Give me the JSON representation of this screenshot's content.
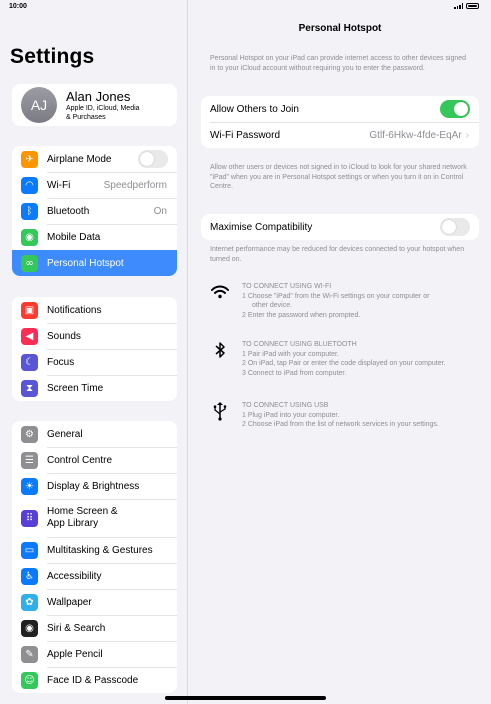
{
  "status": {
    "time": "10:00"
  },
  "sidebar": {
    "title": "Settings",
    "profile": {
      "initials": "AJ",
      "name": "Alan Jones",
      "sub1": "Apple ID, iCloud, Media",
      "sub2": "& Purchases"
    },
    "group1": [
      {
        "label": "Airplane Mode",
        "icon": "airplane-icon",
        "color": "#ff9500",
        "glyph": "✈",
        "control": "toggle",
        "on": false
      },
      {
        "label": "Wi-Fi",
        "icon": "wifi-icon",
        "color": "#0a7aff",
        "glyph": "◠",
        "value": "Speedperform"
      },
      {
        "label": "Bluetooth",
        "icon": "bluetooth-icon",
        "color": "#0a7aff",
        "glyph": "ᛒ",
        "value": "On"
      },
      {
        "label": "Mobile Data",
        "icon": "antenna-icon",
        "color": "#34c759",
        "glyph": "◉"
      },
      {
        "label": "Personal Hotspot",
        "icon": "hotspot-icon",
        "color": "#34c759",
        "glyph": "∞",
        "selected": true
      }
    ],
    "group2": [
      {
        "label": "Notifications",
        "icon": "bell-icon",
        "color": "#ff3b30",
        "glyph": "▣"
      },
      {
        "label": "Sounds",
        "icon": "speaker-icon",
        "color": "#ff2d55",
        "glyph": "◀"
      },
      {
        "label": "Focus",
        "icon": "moon-icon",
        "color": "#5856d6",
        "glyph": "☾"
      },
      {
        "label": "Screen Time",
        "icon": "hourglass-icon",
        "color": "#5856d6",
        "glyph": "⧗"
      }
    ],
    "group3": [
      {
        "label": "General",
        "icon": "gear-icon",
        "color": "#8e8e93",
        "glyph": "⚙"
      },
      {
        "label": "Control Centre",
        "icon": "switches-icon",
        "color": "#8e8e93",
        "glyph": "☰"
      },
      {
        "label": "Display & Brightness",
        "icon": "sun-icon",
        "color": "#0a7aff",
        "glyph": "☀"
      },
      {
        "label1": "Home Screen &",
        "label2": "App Library",
        "icon": "grid-icon",
        "color": "#5a3fd6",
        "glyph": "⠿",
        "tall": true
      },
      {
        "label": "Multitasking & Gestures",
        "icon": "multitask-icon",
        "color": "#0a7aff",
        "glyph": "▭"
      },
      {
        "label": "Accessibility",
        "icon": "accessibility-icon",
        "color": "#0a7aff",
        "glyph": "♿"
      },
      {
        "label": "Wallpaper",
        "icon": "flower-icon",
        "color": "#30b0e8",
        "glyph": "✿"
      },
      {
        "label": "Siri & Search",
        "icon": "siri-icon",
        "color": "#222",
        "glyph": "◉"
      },
      {
        "label": "Apple Pencil",
        "icon": "pencil-icon",
        "color": "#8e8e93",
        "glyph": "✎"
      },
      {
        "label": "Face ID & Passcode",
        "icon": "faceid-icon",
        "color": "#34c759",
        "glyph": "☺"
      }
    ]
  },
  "main": {
    "title": "Personal Hotspot",
    "intro": "Personal Hotspot on your iPad can provide internet access to other devices signed in to your iCloud account without requiring you to enter the password.",
    "allow_label": "Allow Others to Join",
    "allow_on": true,
    "wifi_password_label": "Wi-Fi Password",
    "wifi_password_value": "Gtlf-6Hkw-4fde-EqAr",
    "allow_note": "Allow other users or devices not signed in to iCloud to look for your shared network \"iPad\" when you are in Personal Hotspot settings or when you turn it on in Control Centre.",
    "maximise_label": "Maximise Compatibility",
    "maximise_on": false,
    "maximise_note": "Internet performance may be reduced for devices connected to your hotspot when turned on.",
    "wifi_section": {
      "heading": "TO CONNECT USING WI-FI",
      "step1a": "1 Choose \"iPad\" from the Wi-Fi settings on your computer or",
      "step1b": "other device.",
      "step2": "2 Enter the password when prompted."
    },
    "bt_section": {
      "heading": "TO CONNECT USING BLUETOOTH",
      "step1": "1 Pair iPad with your computer.",
      "step2": "2 On iPad, tap Pair or enter the code displayed on your computer.",
      "step3": "3 Connect to iPad from computer."
    },
    "usb_section": {
      "heading": "TO CONNECT USING USB",
      "step1": "1 Plug iPad into your computer.",
      "step2": "2 Choose iPad from the list of network services in your settings."
    }
  }
}
